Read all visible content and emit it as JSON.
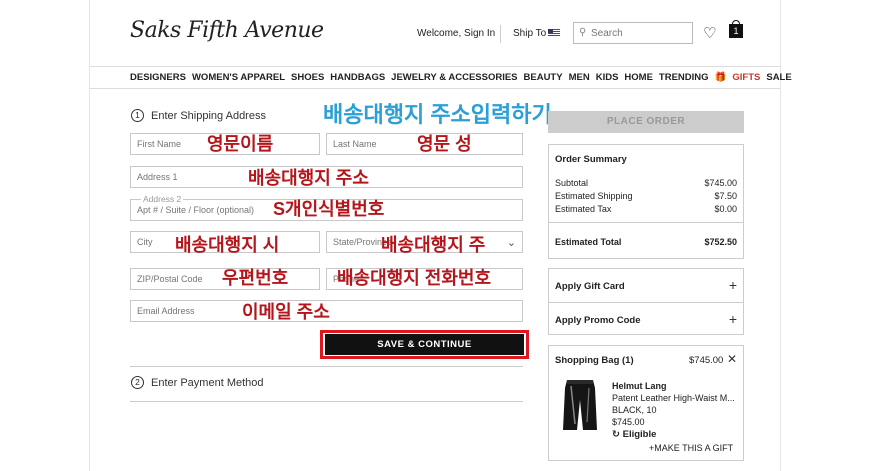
{
  "header": {
    "logo": "Saks Fifth Avenue",
    "welcome": "Welcome, Sign In",
    "ship_to": "Ship To",
    "search_placeholder": "Search",
    "bag_count": "1"
  },
  "nav": {
    "items": [
      "DESIGNERS",
      "WOMEN'S APPAREL",
      "SHOES",
      "HANDBAGS",
      "JEWELRY & ACCESSORIES",
      "BEAUTY",
      "MEN",
      "KIDS",
      "HOME",
      "TRENDING",
      "GIFTS",
      "SALE"
    ]
  },
  "shipping": {
    "step_number": "1",
    "title": "Enter Shipping Address",
    "first_name_placeholder": "First Name",
    "last_name_placeholder": "Last Name",
    "address1_placeholder": "Address 1",
    "address2_label": "Address 2",
    "address2_placeholder": "Apt # / Suite / Floor (optional)",
    "city_placeholder": "City",
    "state_placeholder": "State/Province",
    "zip_placeholder": "ZIP/Postal Code",
    "phone_placeholder": "Phone",
    "email_placeholder": "Email Address",
    "save_label": "SAVE & CONTINUE"
  },
  "payment": {
    "step_number": "2",
    "title": "Enter Payment Method"
  },
  "annotations": {
    "title": "배송대행지 주소입력하기",
    "first_name": "영문이름",
    "last_name": "영문 성",
    "address1": "배송대행지 주소",
    "address2": "S개인식별번호",
    "city": "배송대행지 시",
    "state": "배송대행지 주",
    "zip": "우편번호",
    "phone": "배송대행지 전화번호",
    "email": "이메일 주소"
  },
  "order": {
    "place_order_label": "PLACE ORDER",
    "summary_title": "Order Summary",
    "subtotal_label": "Subtotal",
    "subtotal_value": "$745.00",
    "shipping_label": "Estimated Shipping",
    "shipping_value": "$7.50",
    "tax_label": "Estimated Tax",
    "tax_value": "$0.00",
    "total_label": "Estimated Total",
    "total_value": "$752.50",
    "gift_card_label": "Apply Gift Card",
    "promo_label": "Apply Promo Code"
  },
  "bag": {
    "title": "Shopping Bag (1)",
    "total": "$745.00",
    "brand": "Helmut Lang",
    "product_name": "Patent Leather High-Waist M...",
    "variant": "BLACK, 10",
    "price": "$745.00",
    "eligible_label": "Eligible",
    "gift_label": "MAKE THIS A GIFT"
  },
  "colors": {
    "annotation_red": "#b5161b",
    "annotation_blue": "#2b9fd6",
    "highlight_red": "#e0161e",
    "gifts_red": "#c0392b"
  }
}
